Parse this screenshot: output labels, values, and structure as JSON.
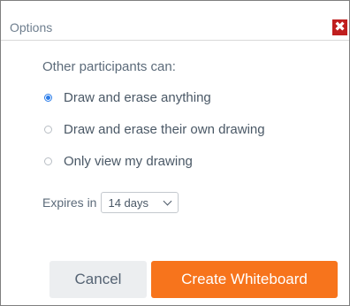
{
  "dialog": {
    "title": "Options",
    "close_glyph": "✖",
    "close_icon": "close-icon",
    "section_label": "Other participants can:",
    "options": [
      {
        "label": "Draw and erase anything",
        "checked": true
      },
      {
        "label": "Draw and erase their own drawing",
        "checked": false
      },
      {
        "label": "Only view my drawing",
        "checked": false
      }
    ],
    "expires": {
      "label": "Expires in",
      "selected": "14 days"
    },
    "buttons": {
      "cancel": "Cancel",
      "create": "Create Whiteboard"
    }
  },
  "colors": {
    "accent": "#f7741c",
    "close": "#c01f1f",
    "radio": "#2b7de9"
  }
}
